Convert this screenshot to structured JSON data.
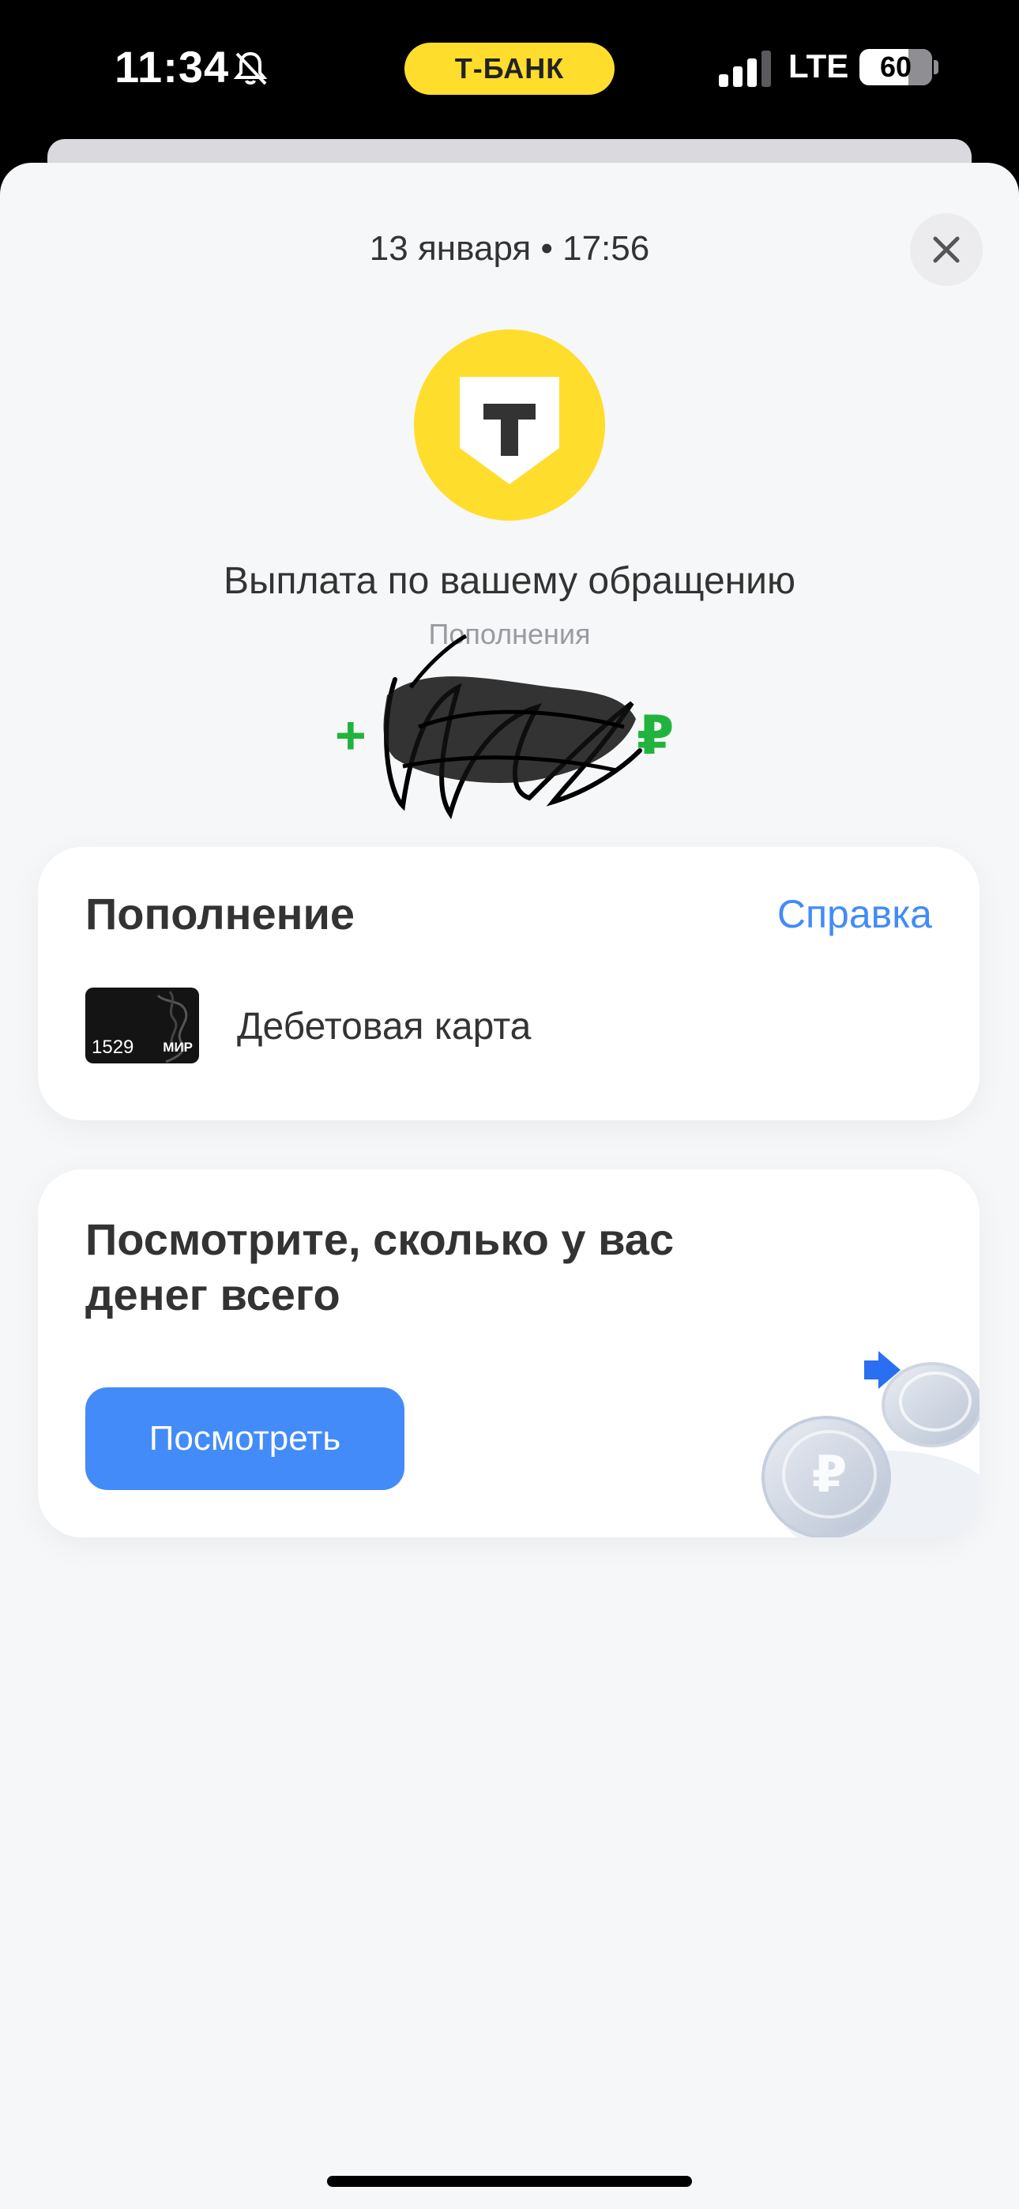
{
  "status_bar": {
    "time": "11:34",
    "carrier_badge": "Т-БАНК",
    "network": "LTE",
    "battery": "60",
    "icons": [
      "bell-muted-icon",
      "signal-icon",
      "battery-icon"
    ]
  },
  "header": {
    "datetime": "13 января • 17:56",
    "logo_letter": "T"
  },
  "transaction": {
    "title": "Выплата по вашему обращению",
    "category": "Пополнения",
    "amount_sign": "+",
    "currency": "₽"
  },
  "card_section": {
    "title": "Пополнение",
    "help_link": "Справка",
    "card_last_digits": "1529",
    "card_network": "МИР",
    "card_label": "Дебетовая карта"
  },
  "promo": {
    "title": "Посмотрите, сколько у вас денег всего",
    "button_label": "Посмотреть"
  },
  "colors": {
    "brand_yellow": "#ffdd2d",
    "accent_blue": "#428bf9",
    "amount_green": "#21b33d"
  }
}
